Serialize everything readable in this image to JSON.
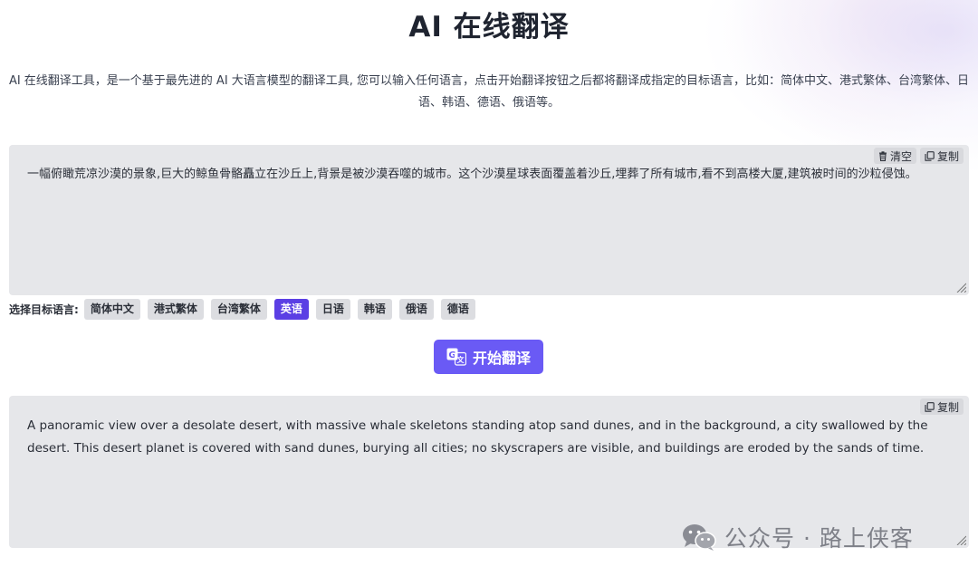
{
  "page": {
    "title": "AI 在线翻译",
    "description": "AI 在线翻译工具，是一个基于最先进的 AI 大语言模型的翻译工具, 您可以输入任何语言，点击开始翻译按钮之后都将翻译成指定的目标语言，比如：简体中文、港式繁体、台湾繁体、日语、韩语、德语、俄语等。"
  },
  "input_panel": {
    "text": "一幅俯瞰荒凉沙漠的景象,巨大的鲸鱼骨骼矗立在沙丘上,背景是被沙漠吞噬的城市。这个沙漠星球表面覆盖着沙丘,埋葬了所有城市,看不到高楼大厦,建筑被时间的沙粒侵蚀。",
    "clear_label": "清空",
    "copy_label": "复制"
  },
  "target_language": {
    "label": "选择目标语言:",
    "options": [
      "简体中文",
      "港式繁体",
      "台湾繁体",
      "英语",
      "日语",
      "韩语",
      "俄语",
      "德语"
    ],
    "selected": "英语"
  },
  "translate_button": {
    "label": "开始翻译"
  },
  "output_panel": {
    "text": "A panoramic view over a desolate desert, with massive whale skeletons standing atop sand dunes, and in the background, a city swallowed by the desert. This desert planet is covered with sand dunes, burying all cities; no skyscrapers are visible, and buildings are eroded by the sands of time.",
    "copy_label": "复制"
  },
  "watermark": {
    "text": "公众号 · 路上侠客"
  },
  "colors": {
    "accent": "#5b3fe4",
    "button": "#6a5af5",
    "panel_bg": "#e6e7ea"
  }
}
